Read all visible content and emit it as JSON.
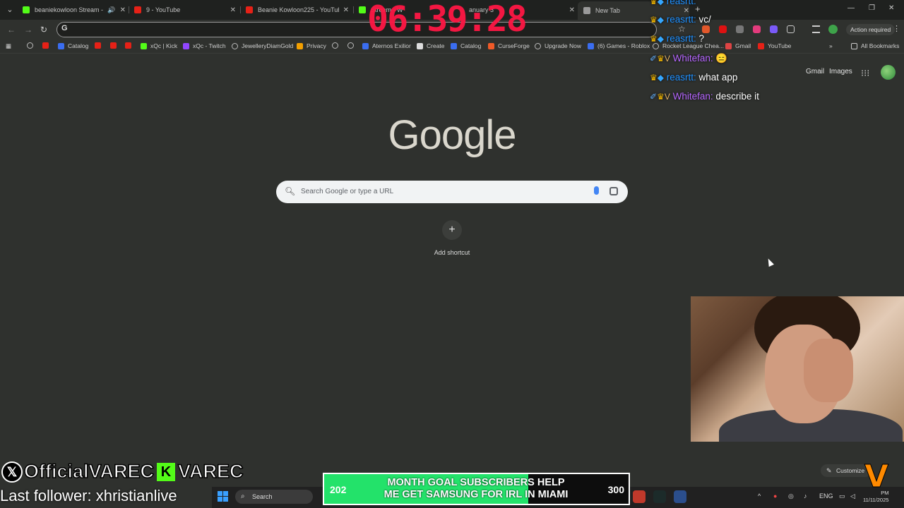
{
  "browser": {
    "tabs": [
      {
        "title": "beaniekowloon Stream - W",
        "icon": "kick-icon",
        "audio": true
      },
      {
        "title": "9 - YouTube",
        "icon": "youtube-icon"
      },
      {
        "title": "Beanie Kowloon225 - YouTube",
        "icon": "youtube-icon"
      },
      {
        "title": "Stream - W",
        "icon": "kick-icon"
      },
      {
        "title": "anuary 3",
        "icon": "youtube-icon"
      },
      {
        "title": "New Tab",
        "icon": "chrome-icon",
        "active": true
      }
    ],
    "omnibox_value": "",
    "omnibox_icon": "G",
    "action_required": "Action required",
    "bookmarks": [
      {
        "label": "",
        "icon": "globe-icon"
      },
      {
        "label": "",
        "icon": "youtube-icon"
      },
      {
        "label": "Catalog",
        "icon": "roblox-icon"
      },
      {
        "label": "",
        "icon": "youtube-icon"
      },
      {
        "label": "",
        "icon": "youtube-icon"
      },
      {
        "label": "",
        "icon": "youtube-icon"
      },
      {
        "label": "xQc | Kick",
        "icon": "kick-icon"
      },
      {
        "label": "xQc - Twitch",
        "icon": "twitch-icon"
      },
      {
        "label": "JewelleryDiamGold",
        "icon": "globe-icon"
      },
      {
        "label": "Privacy",
        "icon": "windows-icon"
      },
      {
        "label": "",
        "icon": "globe-icon"
      },
      {
        "label": "",
        "icon": "google-icon"
      },
      {
        "label": "Aternos Exilior",
        "icon": "aternos-icon"
      },
      {
        "label": "Create",
        "icon": "roblox-icon"
      },
      {
        "label": "Catalog",
        "icon": "roblox-icon"
      },
      {
        "label": "CurseForge",
        "icon": "curseforge-icon"
      },
      {
        "label": "Upgrade Now",
        "icon": "globe-icon"
      },
      {
        "label": "(6) Games - Roblox",
        "icon": "roblox-icon"
      },
      {
        "label": "Rocket League Chea...",
        "icon": "globe-icon"
      },
      {
        "label": "Gmail",
        "icon": "gmail-icon"
      },
      {
        "label": "YouTube",
        "icon": "youtube-icon"
      }
    ],
    "all_bookmarks": "All Bookmarks"
  },
  "ntp": {
    "gmail": "Gmail",
    "images": "Images",
    "logo": "Google",
    "search_placeholder": "Search Google or type a URL",
    "add_shortcut": "Add shortcut",
    "customize": "Customize"
  },
  "overlay": {
    "timer": "06:39:28",
    "chat": [
      {
        "user": "reasrtt:",
        "text": "",
        "role": "partial"
      },
      {
        "user": "reasrtt:",
        "text": "vc/"
      },
      {
        "user": "reasrtt:",
        "text": "?"
      },
      {
        "user": "Whitefan:",
        "text": "😑"
      },
      {
        "user": "reasrtt:",
        "text": "what app"
      },
      {
        "user": "Whitefan:",
        "text": "describe it"
      }
    ],
    "socials_x": "OfficialVAREC",
    "socials_k": "VAREC",
    "last_follower": "Last follower: xhristianlive",
    "goal": {
      "current": "202",
      "max": "300",
      "progress": 0.67,
      "line1": "MONTH GOAL SUBSCRIBERS HELP",
      "line2": "ME GET SAMSUNG FOR IRL IN MIAMI"
    }
  },
  "taskbar": {
    "search": "Search",
    "lang": "ENG",
    "time": "PM",
    "date": "11/11/2025"
  }
}
